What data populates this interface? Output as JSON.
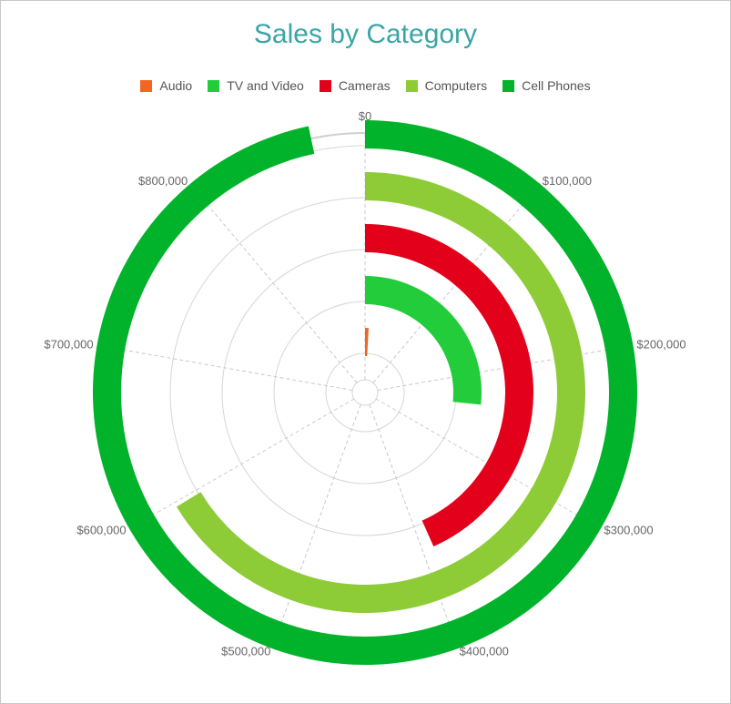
{
  "chart_data": {
    "type": "radial-bar",
    "title": "Sales by Category",
    "legend_position": "top",
    "axis": {
      "min": 0,
      "max": 900000,
      "tick_values": [
        0,
        100000,
        200000,
        300000,
        400000,
        500000,
        600000,
        700000,
        800000
      ],
      "tick_labels": [
        "$0",
        "$100,000",
        "$200,000",
        "$300,000",
        "$400,000",
        "$500,000",
        "$600,000",
        "$700,000",
        "$800,000"
      ],
      "grid": true
    },
    "series": [
      {
        "name": "Audio",
        "value": 8000,
        "color": "#f26522"
      },
      {
        "name": "TV and Video",
        "value": 240000,
        "color": "#22cc3a"
      },
      {
        "name": "Cameras",
        "value": 390000,
        "color": "#e3001a"
      },
      {
        "name": "Computers",
        "value": 597000,
        "color": "#8dcc37"
      },
      {
        "name": "Cell Phones",
        "value": 870000,
        "color": "#00b32a"
      }
    ]
  }
}
